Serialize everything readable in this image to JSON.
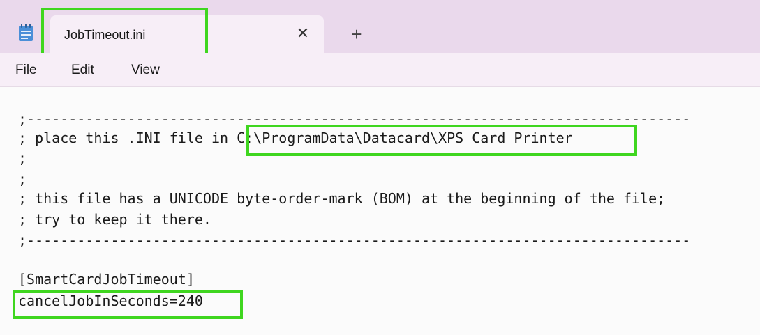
{
  "tab": {
    "title": "JobTimeout.ini",
    "close_glyph": "✕",
    "new_tab_glyph": "+"
  },
  "menu": {
    "file": "File",
    "edit": "Edit",
    "view": "View"
  },
  "editor": {
    "lines": [
      ";-------------------------------------------------------------------------------",
      "; place this .INI file in C:\\ProgramData\\Datacard\\XPS Card Printer",
      ";",
      ";",
      "; this file has a UNICODE byte-order-mark (BOM) at the beginning of the file;",
      "; try to keep it there.",
      ";-------------------------------------------------------------------------------",
      "",
      "[SmartCardJobTimeout]",
      "cancelJobInSeconds=240"
    ]
  },
  "colors": {
    "titlebar": "#ead9ec",
    "highlight": "#3fd61f"
  },
  "icons": {
    "app": "notepad-icon"
  }
}
